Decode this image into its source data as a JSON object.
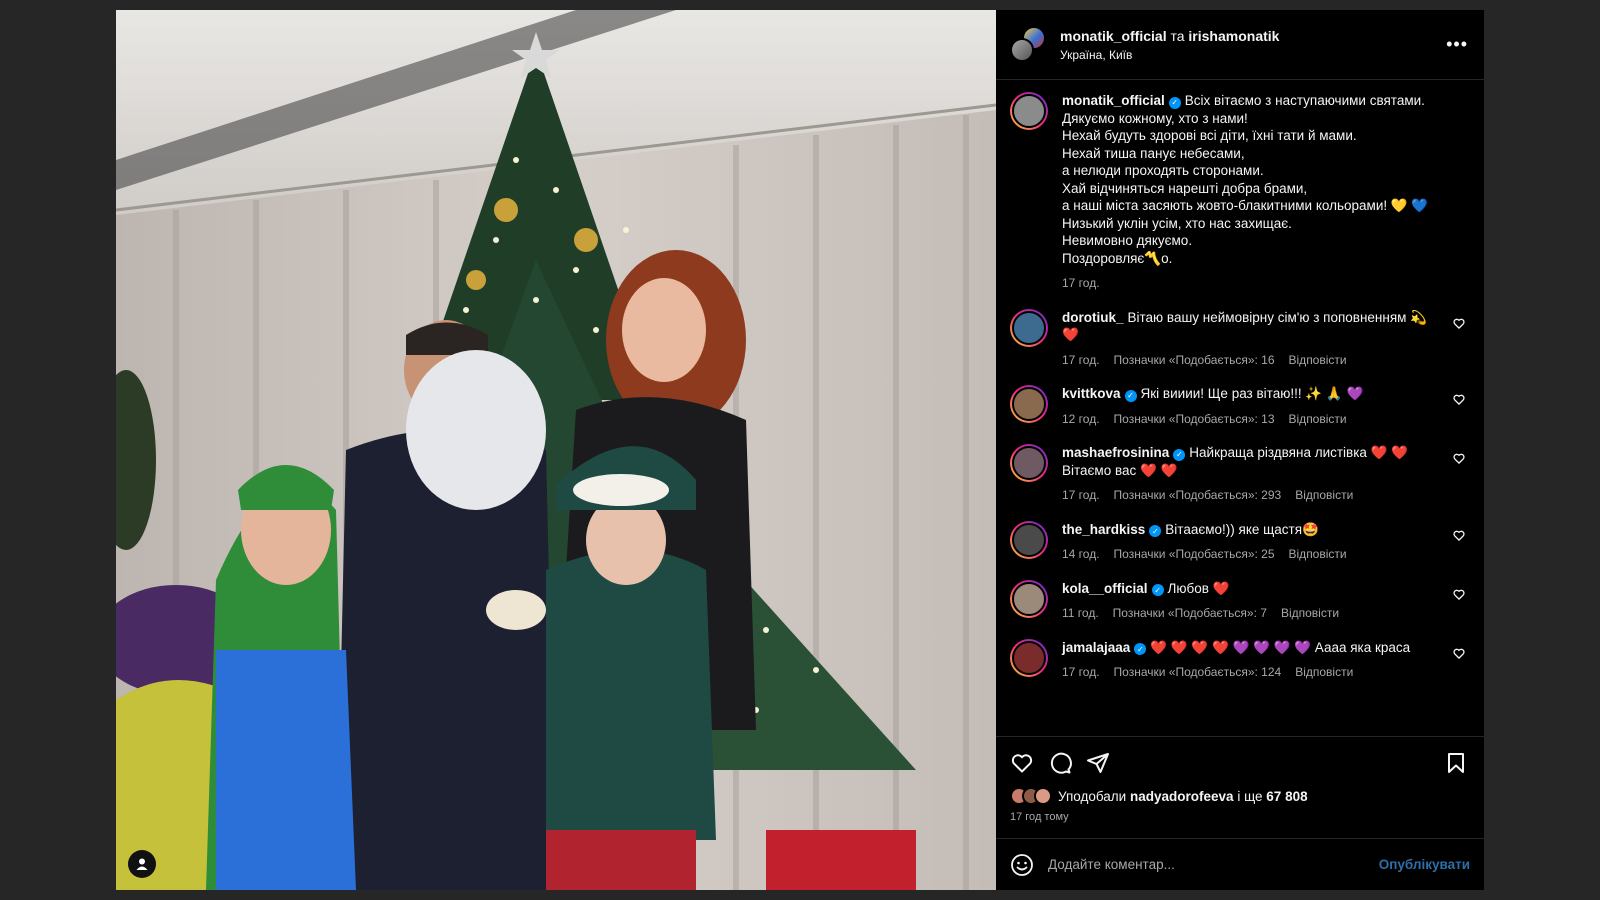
{
  "post": {
    "author": "monatik_official",
    "and_word": "та",
    "coauthor": "irishamonatik",
    "location": "Україна, Київ",
    "more_icon": "more-horizontal-icon"
  },
  "caption": {
    "user": "monatik_official",
    "lines": [
      "Всіх вітаємо з наступаючими святами.",
      "Дякуємо кожному, хто з нами!",
      "Нехай будуть здорові всі діти, їхні тати й мами.",
      "Нехай тиша панує небесами,",
      "а нелюди проходять сторонами.",
      "Хай відчиняться нарешті добра брами,",
      "а наші міста засяють жовто-блакитними кольорами! 💛 💙",
      "Низький уклін усім, хто нас захищає.",
      "Невимовно дякуємо.",
      "Поздоровляє〽️о."
    ],
    "time": "17 год."
  },
  "comments": [
    {
      "user": "dorotiuk_",
      "verified": false,
      "text": "Вітаю вашу неймовірну сім'ю з поповненням 💫 ❤️",
      "time": "17 год.",
      "likes": "Позначки «Подобається»: 16",
      "reply": "Відповісти",
      "color": "#3d6b8f"
    },
    {
      "user": "kvittkova",
      "verified": true,
      "text": "Які вииии! Ще раз вітаю!!! ✨ 🙏 💜",
      "time": "12 год.",
      "likes": "Позначки «Подобається»: 13",
      "reply": "Відповісти",
      "color": "#8a6a4f"
    },
    {
      "user": "mashaefrosinina",
      "verified": true,
      "text": "Найкраща різдвяна листівка ❤️ ❤️ Вітаємо вас ❤️ ❤️",
      "time": "17 год.",
      "likes": "Позначки «Подобається»: 293",
      "reply": "Відповісти",
      "color": "#6f5a63"
    },
    {
      "user": "the_hardkiss",
      "verified": true,
      "text": "Вітааємо!)) яке щастя🤩",
      "time": "14 год.",
      "likes": "Позначки «Подобається»: 25",
      "reply": "Відповісти",
      "color": "#4a4a4a"
    },
    {
      "user": "kola__official",
      "verified": true,
      "text": "Любов ❤️",
      "time": "11 год.",
      "likes": "Позначки «Подобається»: 7",
      "reply": "Відповісти",
      "color": "#9b8a7a"
    },
    {
      "user": "jamalajaaa",
      "verified": true,
      "text": "❤️ ❤️ ❤️ ❤️ 💜 💜 💜 💜 Аааа яка краса",
      "time": "17 год.",
      "likes": "Позначки «Подобається»: 124",
      "reply": "Відповісти",
      "color": "#7a2b2b"
    }
  ],
  "actions": {
    "like_icon": "heart-icon",
    "comment_icon": "comment-icon",
    "share_icon": "paper-plane-icon",
    "save_icon": "bookmark-icon"
  },
  "likes": {
    "prefix": "Уподобали",
    "user": "nadyadorofeeva",
    "middle": "і ще",
    "count": "67 808",
    "avatar_colors": [
      "#c97b6a",
      "#8e5a48",
      "#d99a86"
    ]
  },
  "time_ago": "17 год тому",
  "add_comment": {
    "placeholder": "Додайте коментар...",
    "publish": "Опублікувати",
    "emoji_icon": "smiley-icon"
  }
}
